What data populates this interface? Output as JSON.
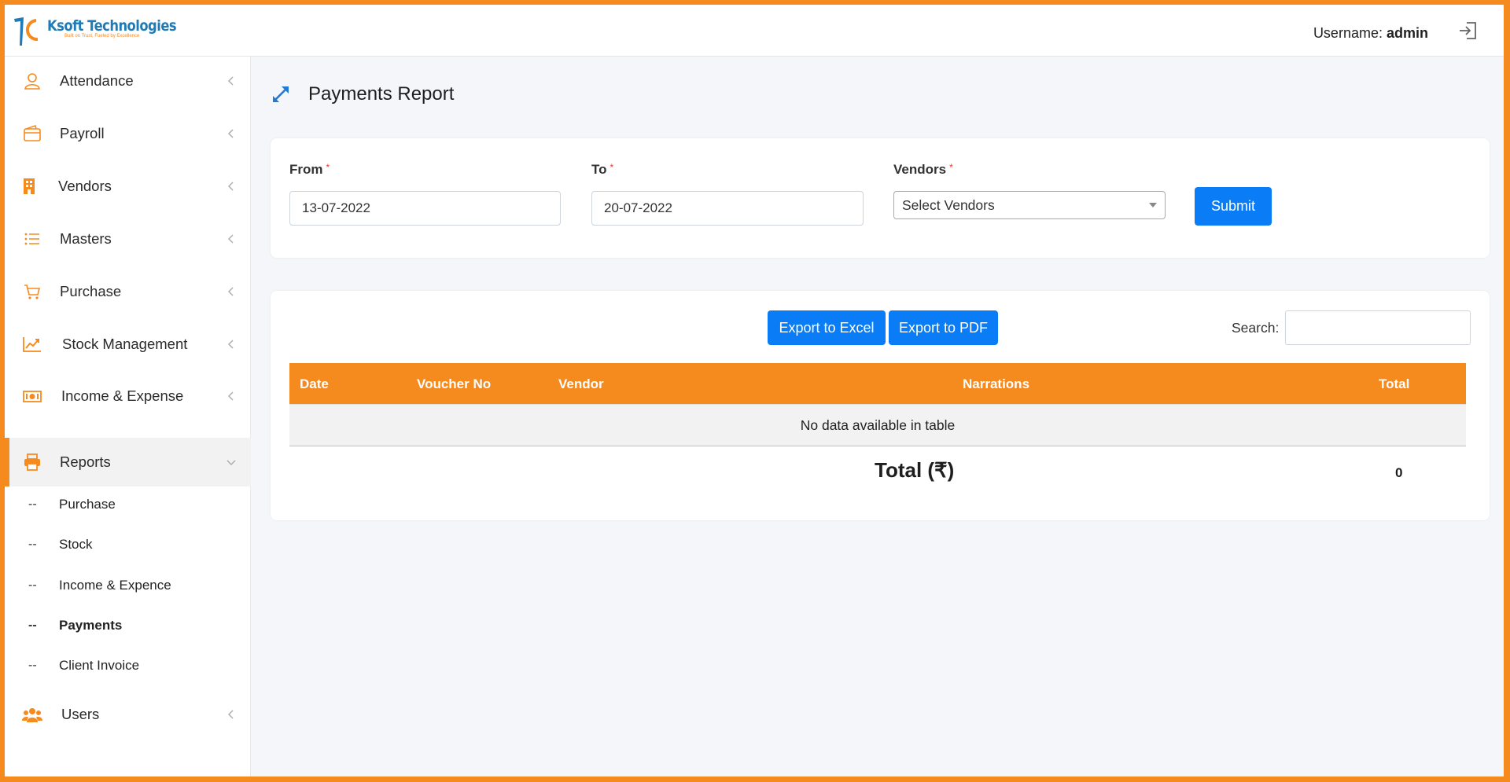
{
  "brand": {
    "name": "Ksoft Technologies",
    "tagline": "Built on Trust, Fueled by Excellence"
  },
  "header": {
    "username_label": "Username:",
    "username": "admin"
  },
  "sidebar": {
    "items": [
      {
        "label": "Attendance",
        "icon": "user-icon"
      },
      {
        "label": "Payroll",
        "icon": "wallet-icon"
      },
      {
        "label": "Vendors",
        "icon": "building-icon"
      },
      {
        "label": "Masters",
        "icon": "list-icon"
      },
      {
        "label": "Purchase",
        "icon": "cart-icon"
      },
      {
        "label": "Stock Management",
        "icon": "chart-line-icon"
      },
      {
        "label": "Income & Expense",
        "icon": "money-icon"
      },
      {
        "label": "Reports",
        "icon": "printer-icon"
      },
      {
        "label": "Users",
        "icon": "users-icon"
      }
    ],
    "reports_sub": [
      {
        "dash": "--",
        "label": "Purchase"
      },
      {
        "dash": "--",
        "label": "Stock"
      },
      {
        "dash": "--",
        "label": "Income & Expence"
      },
      {
        "dash": "--",
        "label": "Payments"
      },
      {
        "dash": "--",
        "label": "Client Invoice"
      }
    ]
  },
  "page": {
    "title": "Payments Report"
  },
  "filters": {
    "from_label": "From",
    "from_value": "13-07-2022",
    "to_label": "To",
    "to_value": "20-07-2022",
    "vendors_label": "Vendors",
    "vendors_value": "Select Vendors",
    "required_mark": "*",
    "submit_label": "Submit"
  },
  "table_tools": {
    "export_excel": "Export to Excel",
    "export_pdf": "Export to PDF",
    "search_label": "Search:",
    "search_value": ""
  },
  "table": {
    "columns": [
      "Date",
      "Voucher No",
      "Vendor",
      "Narrations",
      "Total"
    ],
    "empty_message": "No data available in table",
    "total_label": "Total (₹)",
    "total_value": "0"
  },
  "colors": {
    "accent": "#f58a1f",
    "primary_button": "#0a7cf5",
    "brand_blue": "#1f7bb8"
  }
}
